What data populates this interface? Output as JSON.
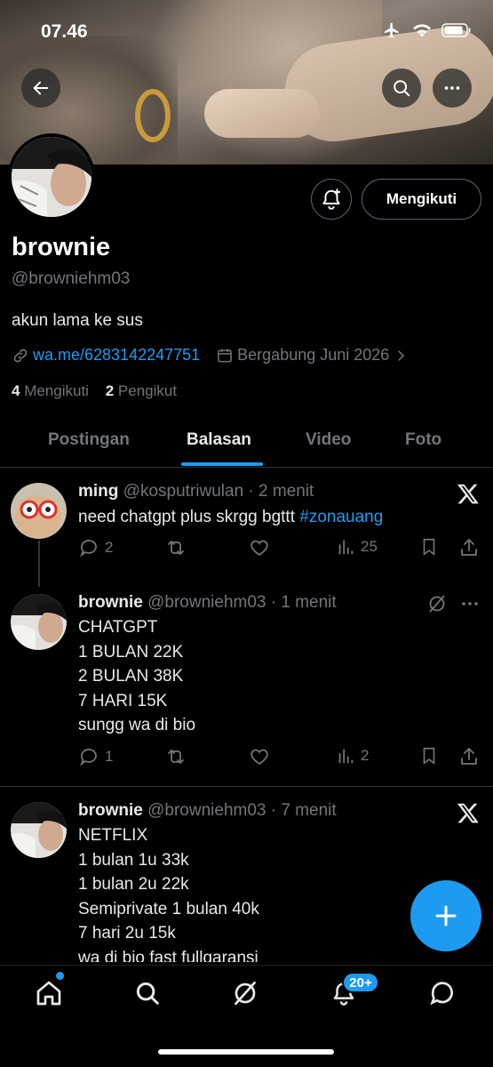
{
  "status_bar": {
    "time": "07.46"
  },
  "profile": {
    "name": "brownie",
    "handle": "@browniehm03",
    "bio": "akun lama ke sus",
    "link": "wa.me/6283142247751",
    "joined": "Bergabung Juni 2026",
    "following_count": "4",
    "following_label": "Mengikuti",
    "followers_count": "2",
    "followers_label": "Pengikut",
    "follow_button": "Mengikuti"
  },
  "tabs": [
    {
      "label": "Postingan"
    },
    {
      "label": "Balasan",
      "active": true
    },
    {
      "label": "Video"
    },
    {
      "label": "Foto"
    }
  ],
  "posts": [
    {
      "name": "ming",
      "handle": "@kosputriwulan",
      "time": "· 2 menit",
      "text_plain": "need chatgpt plus skrgg bgttt ",
      "hashtag": "#zonauang",
      "replies": "2",
      "views": "25",
      "corner_icon": "x-logo-icon"
    },
    {
      "name": "brownie",
      "handle": "@browniehm03",
      "time": "· 1 menit",
      "lines": [
        "CHATGPT",
        "1 BULAN 22K",
        "2 BULAN 38K",
        "7 HARI 15K",
        "sungg wa di bio"
      ],
      "replies": "1",
      "views": "2",
      "corner_icon": "grok-icon"
    },
    {
      "name": "brownie",
      "handle": "@browniehm03",
      "time": "· 7 menit",
      "lines": [
        "NETFLIX",
        "1 bulan 1u 33k",
        "1 bulan 2u 22k",
        "Semiprivate 1 bulan 40k",
        "7 hari 2u 15k",
        "wa di bio fast fullgaransi"
      ],
      "corner_icon": "x-logo-icon"
    }
  ],
  "bottom_nav": {
    "notifications_badge": "20+"
  },
  "colors": {
    "accent": "#1d9bf0",
    "background": "#000000",
    "muted": "#71767b"
  }
}
